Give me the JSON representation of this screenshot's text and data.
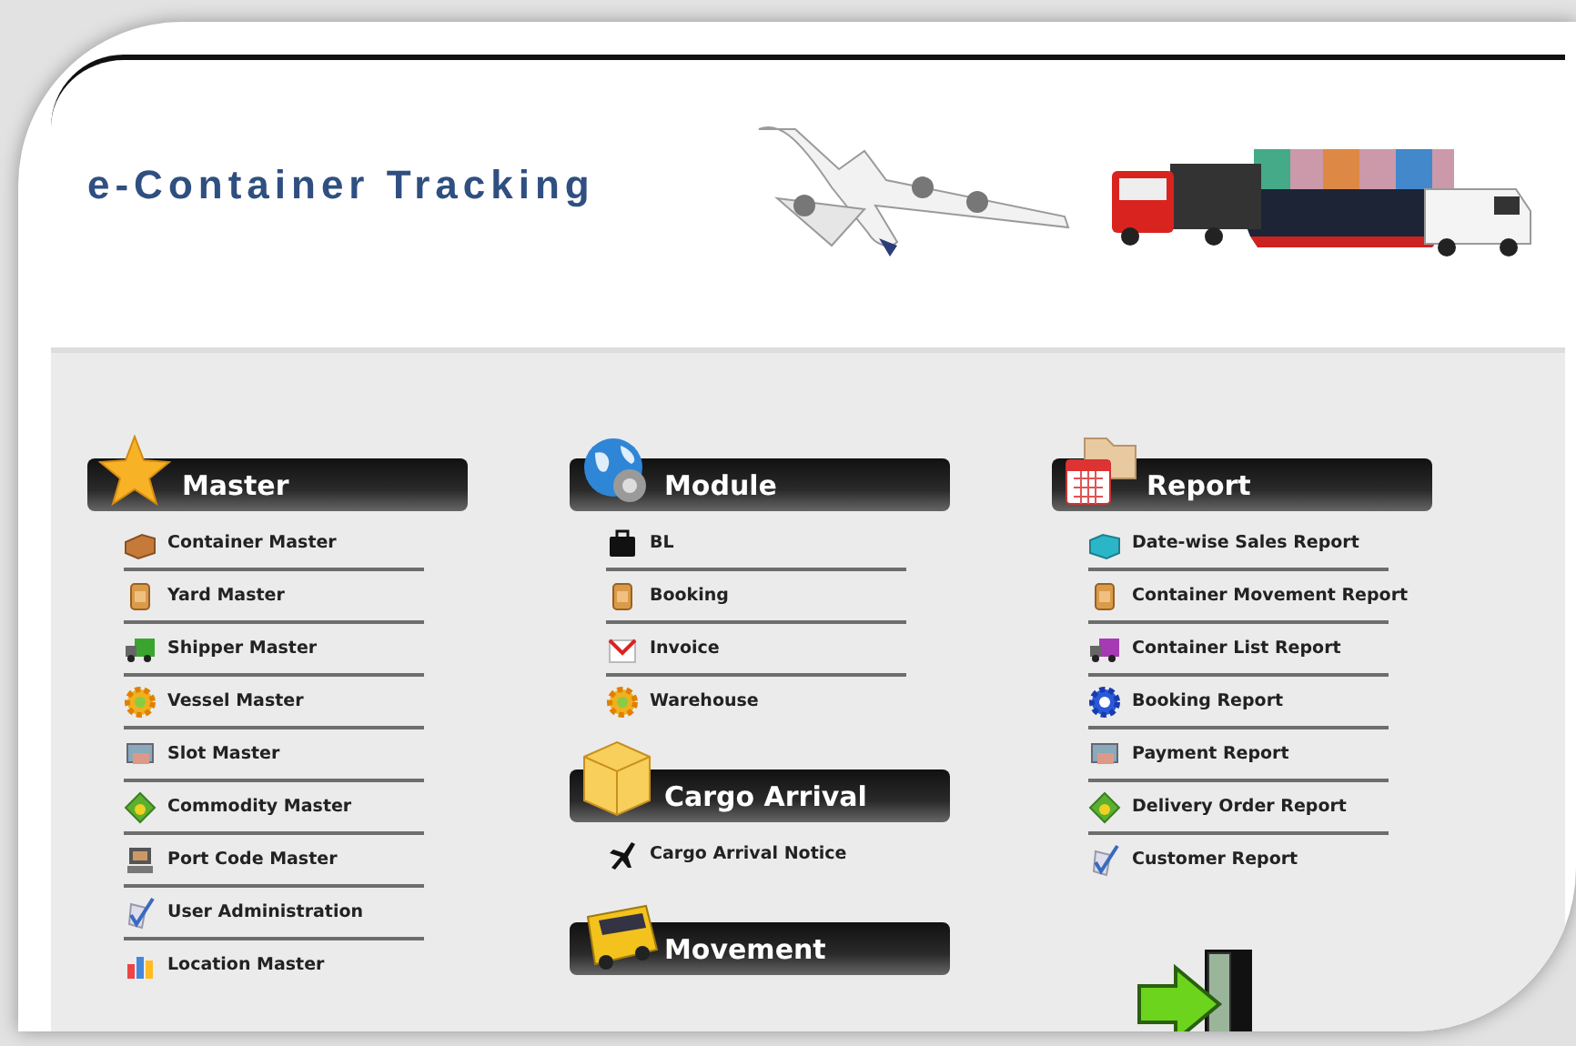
{
  "header": {
    "title": "e-Container Tracking"
  },
  "columns": [
    [
      {
        "title": "Master",
        "kind": "star",
        "items": [
          {
            "label": "Container Master",
            "kind": "crate"
          },
          {
            "label": "Yard Master",
            "kind": "bin"
          },
          {
            "label": "Shipper Master",
            "kind": "truck"
          },
          {
            "label": "Vessel Master",
            "kind": "gear"
          },
          {
            "label": "Slot Master",
            "kind": "screen"
          },
          {
            "label": "Commodity Master",
            "kind": "diamond"
          },
          {
            "label": "Port Code Master",
            "kind": "computer"
          },
          {
            "label": "User Administration",
            "kind": "tick"
          },
          {
            "label": "Location Master",
            "kind": "chart"
          }
        ]
      }
    ],
    [
      {
        "title": "Module",
        "kind": "globe",
        "items": [
          {
            "label": "BL",
            "kind": "bag"
          },
          {
            "label": "Booking",
            "kind": "bin"
          },
          {
            "label": "Invoice",
            "kind": "mail"
          },
          {
            "label": "Warehouse",
            "kind": "gear"
          }
        ]
      },
      {
        "title": "Cargo Arrival",
        "kind": "box",
        "items": [
          {
            "label": "Cargo Arrival Notice",
            "kind": "plane"
          }
        ]
      },
      {
        "title": "Movement",
        "kind": "bus"
      }
    ],
    [
      {
        "title": "Report",
        "kind": "calendar",
        "items": [
          {
            "label": "Date-wise Sales Report",
            "kind": "cube"
          },
          {
            "label": "Container Movement Report",
            "kind": "bin"
          },
          {
            "label": "Container List Report",
            "kind": "truck2"
          },
          {
            "label": "Booking Report",
            "kind": "cog"
          },
          {
            "label": "Payment Report",
            "kind": "screen"
          },
          {
            "label": "Delivery Order Report",
            "kind": "diamond"
          },
          {
            "label": "Customer Report",
            "kind": "tick"
          }
        ]
      }
    ]
  ]
}
